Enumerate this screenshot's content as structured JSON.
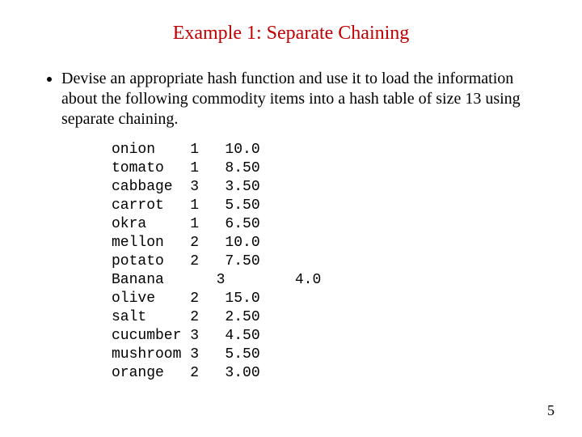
{
  "title": "Example 1: Separate Chaining",
  "bullet_text": "Devise an appropriate hash function and use it to load the information about the following commodity items into a hash table of size 13 using separate chaining.",
  "rows": [
    {
      "name": "onion",
      "qty": "1",
      "price": "10.0",
      "shift": false
    },
    {
      "name": "tomato",
      "qty": "1",
      "price": "8.50",
      "shift": false
    },
    {
      "name": "cabbage",
      "qty": "3",
      "price": "3.50",
      "shift": false
    },
    {
      "name": "carrot",
      "qty": "1",
      "price": "5.50",
      "shift": false
    },
    {
      "name": "okra",
      "qty": "1",
      "price": "6.50",
      "shift": false
    },
    {
      "name": "mellon",
      "qty": "2",
      "price": "10.0",
      "shift": false
    },
    {
      "name": "potato",
      "qty": "2",
      "price": "7.50",
      "shift": false
    },
    {
      "name": "Banana",
      "qty": "3",
      "price": "4.0",
      "shift": true
    },
    {
      "name": "olive",
      "qty": "2",
      "price": "15.0",
      "shift": false
    },
    {
      "name": "salt",
      "qty": "2",
      "price": "2.50",
      "shift": false
    },
    {
      "name": "cucumber",
      "qty": "3",
      "price": "4.50",
      "shift": false
    },
    {
      "name": "mushroom",
      "qty": "3",
      "price": "5.50",
      "shift": false
    },
    {
      "name": "orange",
      "qty": "2",
      "price": "3.00",
      "shift": false
    }
  ],
  "page_number": "5"
}
